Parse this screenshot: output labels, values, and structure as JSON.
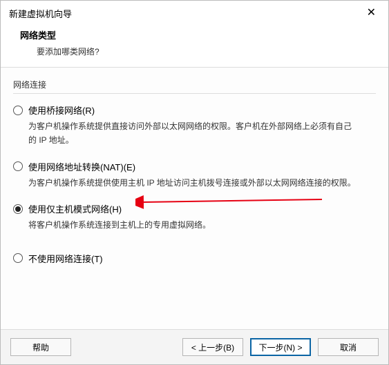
{
  "window": {
    "title": "新建虚拟机向导",
    "close_glyph": "✕"
  },
  "header": {
    "title": "网络类型",
    "subtitle": "要添加哪类网络?"
  },
  "fieldset_label": "网络连接",
  "options": [
    {
      "label": "使用桥接网络(R)",
      "desc": "为客户机操作系统提供直接访问外部以太网网络的权限。客户机在外部网络上必须有自己的 IP 地址。",
      "checked": false
    },
    {
      "label": "使用网络地址转换(NAT)(E)",
      "desc": "为客户机操作系统提供使用主机 IP 地址访问主机拨号连接或外部以太网网络连接的权限。",
      "checked": false
    },
    {
      "label": "使用仅主机模式网络(H)",
      "desc": "将客户机操作系统连接到主机上的专用虚拟网络。",
      "checked": true
    },
    {
      "label": "不使用网络连接(T)",
      "desc": "",
      "checked": false
    }
  ],
  "footer": {
    "help": "帮助",
    "back": "< 上一步(B)",
    "next": "下一步(N) >",
    "cancel": "取消"
  }
}
